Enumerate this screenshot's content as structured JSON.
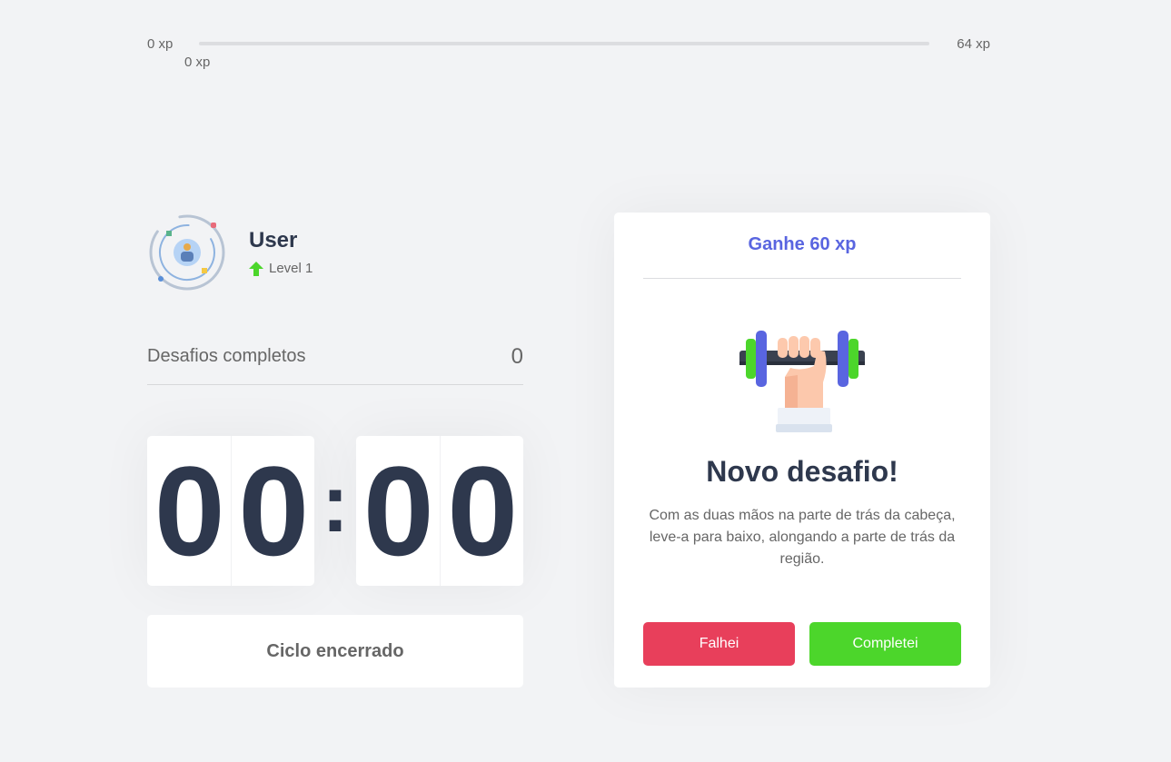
{
  "experience": {
    "min_label": "0 xp",
    "max_label": "64 xp",
    "current_label": "0 xp",
    "progress_percent": 0
  },
  "profile": {
    "name": "User",
    "level_label": "Level 1",
    "level_icon": "level-up-arrow-icon"
  },
  "completed_challenges": {
    "label": "Desafios completos",
    "value": "0"
  },
  "countdown": {
    "minute_left": "0",
    "minute_right": "0",
    "separator": ":",
    "second_left": "0",
    "second_right": "0"
  },
  "cycle_button": {
    "label": "Ciclo encerrado"
  },
  "challenge": {
    "xp_label": "Ganhe 60 xp",
    "title": "Novo desafio!",
    "description": "Com as duas mãos na parte de trás da cabeça, leve-a para baixo, alongando a parte de trás da região.",
    "fail_label": "Falhei",
    "complete_label": "Completei",
    "icon": "dumbbell-icon"
  },
  "colors": {
    "background": "#f2f3f5",
    "title": "#2e384d",
    "text": "#666666",
    "accent_blue": "#5965e0",
    "red": "#e83f5b",
    "green": "#4cd62b"
  }
}
